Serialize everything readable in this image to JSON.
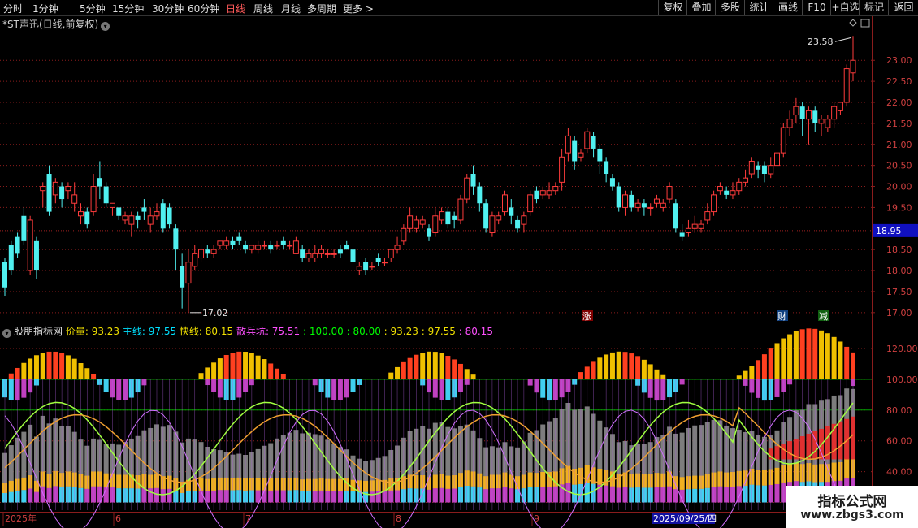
{
  "toolbar": {
    "periods": [
      "分时",
      "1分钟",
      "5分钟",
      "15分钟",
      "30分钟",
      "60分钟",
      "日线",
      "周线",
      "月线",
      "多周期",
      "更多"
    ],
    "active_period": "日线",
    "right_buttons": [
      "复权",
      "叠加",
      "多股",
      "统计",
      "画线",
      "F10",
      "+自选",
      "标记",
      "返回"
    ]
  },
  "stock": {
    "title": "*ST声迅(日线,前复权)"
  },
  "price_panel": {
    "y_ticks": [
      "23.00",
      "22.50",
      "22.00",
      "21.50",
      "21.00",
      "20.50",
      "20.00",
      "19.50",
      "18.95",
      "18.50",
      "18.00",
      "17.50",
      "17.00"
    ],
    "current_price": "18.95",
    "max_label": "23.58",
    "min_label": "17.02",
    "markers": [
      "涨",
      "财",
      "减"
    ]
  },
  "indicator": {
    "name": "股朋指标网",
    "items": [
      {
        "label": "价量:",
        "value": "93.23",
        "color": "#f0e000"
      },
      {
        "label": "主线:",
        "value": "97.55",
        "color": "#00e0ff"
      },
      {
        "label": "快线:",
        "value": "80.15",
        "color": "#f0e000"
      },
      {
        "label": "散兵坑:",
        "value": "75.51",
        "color": "#ff50ff"
      },
      {
        "label": ":",
        "value": "100.00",
        "color": "#00ff00"
      },
      {
        "label": ":",
        "value": "80.00",
        "color": "#00ff00"
      },
      {
        "label": ":",
        "value": "93.23",
        "color": "#f0e000"
      },
      {
        "label": ":",
        "value": "97.55",
        "color": "#f0e000"
      },
      {
        "label": ":",
        "value": "80.15",
        "color": "#ff50ff"
      }
    ],
    "y_ticks": [
      "120.00",
      "100.00",
      "80.00",
      "60.00",
      "40.00",
      "20.00"
    ]
  },
  "x_axis": {
    "labels": [
      "2025年",
      "6",
      "7",
      "8",
      "9"
    ],
    "cursor_date": "2025/09/25/四"
  },
  "watermark": {
    "line1": "指标公式网",
    "line2": "www.zbgs3.com"
  },
  "colors": {
    "up": "#ff3c3c",
    "down": "#50f0f0",
    "grid": "#8a1c1c",
    "bg": "#000000"
  },
  "chart_data": {
    "type": "candlestick",
    "ylim": [
      16.9,
      23.7
    ],
    "candles": [
      [
        18.2,
        17.6,
        18.3,
        17.4
      ],
      [
        18.6,
        18.0,
        18.7,
        17.9
      ],
      [
        18.8,
        18.4,
        18.9,
        18.3
      ],
      [
        19.3,
        18.7,
        19.5,
        18.6
      ],
      [
        18.0,
        19.2,
        19.3,
        17.9
      ],
      [
        18.7,
        18.0,
        18.8,
        17.8
      ],
      [
        19.9,
        20.0,
        20.1,
        19.5
      ],
      [
        20.3,
        19.4,
        20.5,
        19.3
      ],
      [
        19.8,
        20.1,
        20.2,
        19.6
      ],
      [
        20.0,
        19.7,
        20.1,
        19.5
      ],
      [
        19.9,
        20.0,
        20.1,
        19.7
      ],
      [
        19.6,
        19.8,
        20.1,
        19.4
      ],
      [
        19.3,
        19.4,
        19.6,
        19.1
      ],
      [
        19.4,
        19.1,
        19.5,
        19.0
      ],
      [
        19.4,
        20.0,
        20.3,
        19.3
      ],
      [
        20.2,
        20.0,
        20.6,
        19.7
      ],
      [
        20.0,
        19.6,
        20.1,
        19.5
      ],
      [
        19.5,
        19.6,
        19.6,
        19.3
      ],
      [
        19.5,
        19.3,
        19.5,
        19.2
      ],
      [
        19.2,
        19.3,
        19.4,
        19.1
      ],
      [
        19.1,
        19.3,
        19.4,
        18.8
      ],
      [
        19.3,
        19.2,
        19.4,
        19.0
      ],
      [
        19.5,
        19.4,
        19.7,
        19.2
      ],
      [
        19.1,
        19.3,
        19.5,
        18.9
      ],
      [
        19.3,
        19.4,
        19.6,
        19.2
      ],
      [
        19.6,
        19.0,
        19.7,
        18.9
      ],
      [
        19.5,
        19.1,
        19.6,
        19.0
      ],
      [
        19.0,
        18.5,
        19.1,
        18.0
      ],
      [
        18.1,
        17.6,
        18.4,
        17.1
      ],
      [
        17.7,
        18.2,
        18.5,
        17.0
      ],
      [
        18.1,
        18.4,
        18.6,
        18.0
      ],
      [
        18.3,
        18.5,
        18.6,
        18.2
      ],
      [
        18.5,
        18.4,
        18.6,
        18.3
      ],
      [
        18.4,
        18.5,
        18.6,
        18.3
      ],
      [
        18.6,
        18.7,
        18.7,
        18.5
      ],
      [
        18.6,
        18.7,
        18.8,
        18.5
      ],
      [
        18.7,
        18.6,
        18.8,
        18.5
      ],
      [
        18.8,
        18.7,
        18.9,
        18.6
      ],
      [
        18.6,
        18.5,
        18.7,
        18.4
      ],
      [
        18.5,
        18.6,
        18.6,
        18.4
      ],
      [
        18.5,
        18.6,
        18.7,
        18.4
      ],
      [
        18.6,
        18.6,
        18.7,
        18.5
      ],
      [
        18.6,
        18.5,
        18.7,
        18.4
      ],
      [
        18.6,
        18.6,
        18.7,
        18.5
      ],
      [
        18.7,
        18.6,
        18.8,
        18.5
      ],
      [
        18.6,
        18.6,
        18.7,
        18.5
      ],
      [
        18.4,
        18.7,
        18.8,
        18.4
      ],
      [
        18.5,
        18.3,
        18.6,
        18.2
      ],
      [
        18.3,
        18.4,
        18.5,
        18.2
      ],
      [
        18.3,
        18.4,
        18.6,
        18.2
      ],
      [
        18.4,
        18.5,
        18.6,
        18.3
      ],
      [
        18.4,
        18.4,
        18.5,
        18.3
      ],
      [
        18.4,
        18.4,
        18.5,
        18.3
      ],
      [
        18.5,
        18.4,
        18.6,
        18.3
      ],
      [
        18.6,
        18.5,
        18.7,
        18.5
      ],
      [
        18.5,
        18.2,
        18.6,
        18.1
      ],
      [
        18.0,
        18.1,
        18.2,
        17.9
      ],
      [
        18.2,
        18.0,
        18.3,
        17.9
      ],
      [
        18.1,
        18.1,
        18.2,
        18.0
      ],
      [
        18.3,
        18.2,
        18.4,
        18.1
      ],
      [
        18.2,
        18.2,
        18.3,
        18.1
      ],
      [
        18.3,
        18.5,
        18.5,
        18.2
      ],
      [
        18.5,
        18.6,
        18.8,
        18.4
      ],
      [
        18.7,
        19.0,
        19.1,
        18.6
      ],
      [
        19.0,
        19.3,
        19.5,
        18.9
      ],
      [
        19.0,
        19.2,
        19.3,
        18.9
      ],
      [
        19.1,
        19.2,
        19.3,
        19.0
      ],
      [
        19.0,
        18.8,
        19.1,
        18.7
      ],
      [
        18.9,
        19.3,
        19.5,
        18.8
      ],
      [
        19.2,
        19.4,
        19.5,
        19.1
      ],
      [
        19.4,
        19.1,
        19.5,
        19.0
      ],
      [
        19.3,
        19.2,
        19.4,
        19.0
      ],
      [
        19.2,
        19.7,
        19.8,
        19.1
      ],
      [
        19.7,
        20.2,
        20.3,
        19.6
      ],
      [
        20.3,
        20.0,
        20.5,
        19.8
      ],
      [
        20.0,
        19.6,
        20.1,
        19.4
      ],
      [
        19.6,
        19.0,
        19.7,
        18.9
      ],
      [
        18.9,
        19.3,
        19.4,
        18.8
      ],
      [
        19.2,
        19.3,
        19.4,
        19.1
      ],
      [
        19.4,
        19.8,
        19.9,
        19.3
      ],
      [
        19.5,
        19.3,
        19.7,
        19.1
      ],
      [
        19.2,
        19.0,
        19.3,
        18.9
      ],
      [
        19.1,
        19.3,
        19.4,
        18.9
      ],
      [
        19.4,
        19.8,
        19.9,
        19.3
      ],
      [
        19.9,
        19.7,
        20.0,
        19.6
      ],
      [
        19.8,
        19.9,
        20.0,
        19.7
      ],
      [
        19.8,
        19.9,
        20.1,
        19.7
      ],
      [
        19.9,
        20.0,
        20.1,
        19.8
      ],
      [
        20.1,
        20.7,
        20.9,
        19.9
      ],
      [
        20.8,
        21.2,
        21.4,
        20.6
      ],
      [
        21.1,
        20.6,
        21.2,
        20.4
      ],
      [
        20.7,
        20.8,
        20.9,
        20.6
      ],
      [
        20.9,
        21.3,
        21.4,
        20.8
      ],
      [
        21.2,
        20.9,
        21.3,
        20.7
      ],
      [
        20.9,
        20.6,
        21.0,
        20.3
      ],
      [
        20.6,
        20.3,
        20.7,
        20.1
      ],
      [
        20.2,
        20.0,
        20.3,
        19.9
      ],
      [
        20.0,
        19.5,
        20.1,
        19.4
      ],
      [
        19.5,
        19.8,
        19.9,
        19.3
      ],
      [
        19.8,
        19.5,
        19.9,
        19.4
      ],
      [
        19.5,
        19.6,
        19.7,
        19.4
      ],
      [
        19.6,
        19.5,
        19.7,
        19.3
      ],
      [
        19.5,
        19.5,
        19.6,
        19.3
      ],
      [
        19.6,
        19.7,
        19.8,
        19.5
      ],
      [
        19.5,
        19.6,
        19.7,
        19.4
      ],
      [
        19.7,
        20.0,
        20.1,
        19.6
      ],
      [
        19.6,
        19.0,
        19.7,
        18.9
      ],
      [
        18.9,
        18.8,
        19.1,
        18.7
      ],
      [
        18.9,
        19.0,
        19.2,
        18.8
      ],
      [
        19.0,
        19.1,
        19.3,
        18.9
      ],
      [
        19.0,
        19.1,
        19.2,
        18.9
      ],
      [
        19.2,
        19.4,
        19.6,
        19.1
      ],
      [
        19.4,
        19.8,
        19.9,
        19.3
      ],
      [
        19.9,
        20.0,
        20.1,
        19.8
      ],
      [
        19.9,
        19.8,
        20.0,
        19.7
      ],
      [
        19.8,
        19.9,
        20.1,
        19.7
      ],
      [
        19.9,
        20.1,
        20.2,
        19.8
      ],
      [
        20.1,
        20.2,
        20.4,
        20.0
      ],
      [
        20.3,
        20.6,
        20.7,
        20.2
      ],
      [
        20.5,
        20.4,
        20.6,
        20.2
      ],
      [
        20.5,
        20.3,
        20.6,
        20.1
      ],
      [
        20.3,
        20.5,
        20.7,
        20.2
      ],
      [
        20.5,
        20.8,
        21.0,
        20.4
      ],
      [
        20.8,
        21.4,
        21.5,
        20.7
      ],
      [
        21.4,
        21.6,
        21.8,
        21.2
      ],
      [
        21.7,
        21.9,
        22.1,
        21.5
      ],
      [
        21.9,
        21.6,
        22.0,
        21.2
      ],
      [
        21.6,
        21.8,
        21.9,
        21.0
      ],
      [
        21.8,
        21.5,
        21.9,
        21.3
      ],
      [
        21.5,
        21.6,
        21.7,
        21.2
      ],
      [
        21.4,
        21.6,
        21.7,
        21.3
      ],
      [
        21.6,
        21.9,
        22.0,
        21.4
      ],
      [
        21.8,
        22.0,
        22.0,
        21.7
      ],
      [
        22.0,
        22.8,
        22.9,
        21.9
      ],
      [
        22.7,
        23.0,
        23.58,
        22.5
      ]
    ]
  }
}
